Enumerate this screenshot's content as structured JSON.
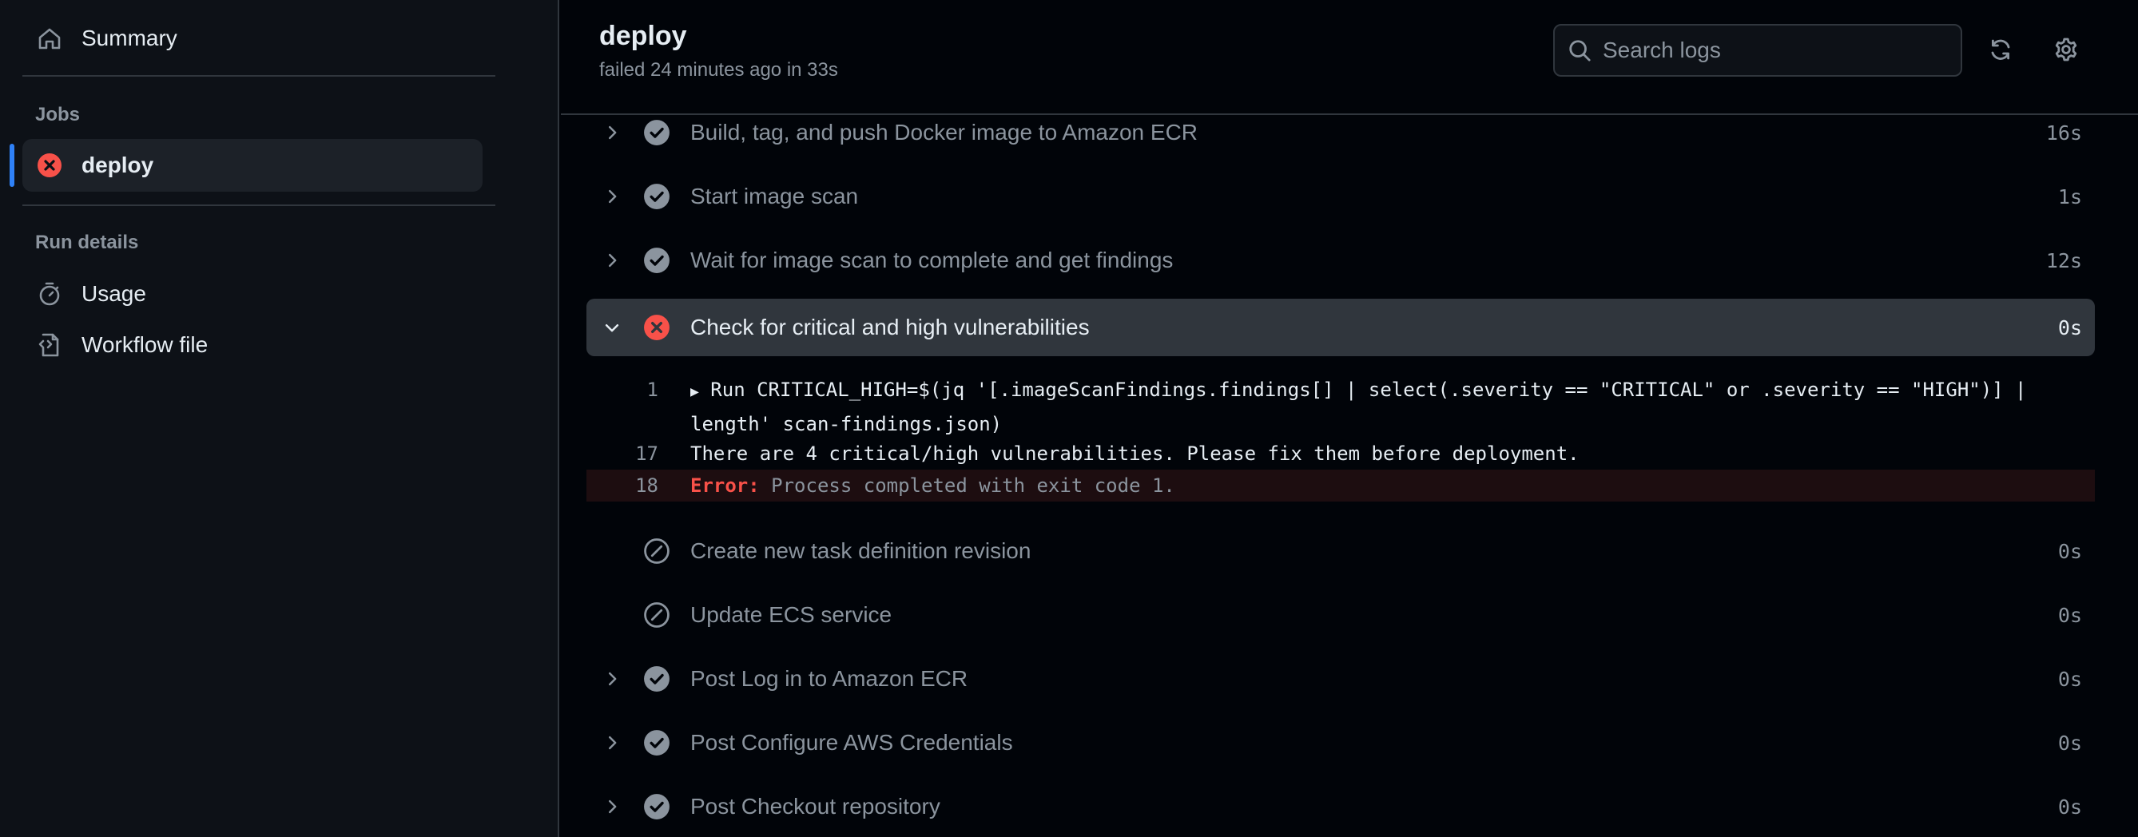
{
  "sidebar": {
    "summary_label": "Summary",
    "jobs_heading": "Jobs",
    "job": {
      "label": "deploy",
      "status": "failed"
    },
    "run_details_heading": "Run details",
    "usage_label": "Usage",
    "workflow_file_label": "Workflow file"
  },
  "header": {
    "title": "deploy",
    "subtitle": "failed 24 minutes ago in 33s",
    "search_placeholder": "Search logs"
  },
  "steps": [
    {
      "label": "Build, tag, and push Docker image to Amazon ECR",
      "duration": "16s",
      "status": "success"
    },
    {
      "label": "Start image scan",
      "duration": "1s",
      "status": "success"
    },
    {
      "label": "Wait for image scan to complete and get findings",
      "duration": "12s",
      "status": "success"
    },
    {
      "label": "Check for critical and high vulnerabilities",
      "duration": "0s",
      "status": "failure",
      "expanded": true
    },
    {
      "label": "Create new task definition revision",
      "duration": "0s",
      "status": "skipped"
    },
    {
      "label": "Update ECS service",
      "duration": "0s",
      "status": "skipped"
    },
    {
      "label": "Post Log in to Amazon ECR",
      "duration": "0s",
      "status": "success"
    },
    {
      "label": "Post Configure AWS Credentials",
      "duration": "0s",
      "status": "success"
    },
    {
      "label": "Post Checkout repository",
      "duration": "0s",
      "status": "success"
    }
  ],
  "log": [
    {
      "num": "1",
      "text": "Run CRITICAL_HIGH=$(jq '[.imageScanFindings.findings[] | select(.severity == \"CRITICAL\" or .severity == \"HIGH\")] | length' scan-findings.json)"
    },
    {
      "num": "17",
      "text": "There are 4 critical/high vulnerabilities. Please fix them before deployment."
    },
    {
      "num": "18",
      "error_keyword": "Error:",
      "error_text": " Process completed with exit code 1."
    }
  ],
  "colors": {
    "success": "#8b949e",
    "failure": "#f85149",
    "accent": "#2f81f7"
  }
}
